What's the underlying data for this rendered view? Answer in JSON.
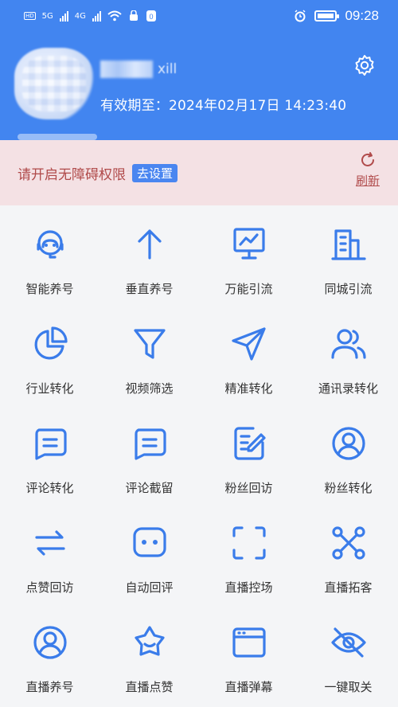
{
  "status_bar": {
    "time": "09:28",
    "net_1": "5G",
    "net_2": "4G"
  },
  "profile": {
    "username_suffix": "xill",
    "expiry": "有效期至：2024年02月17日 14:23:40"
  },
  "notice": {
    "text": "请开启无障碍权限",
    "action": "去设置",
    "refresh": "刷新"
  },
  "features": [
    {
      "label": "智能养号",
      "icon": "robot-icon"
    },
    {
      "label": "垂直养号",
      "icon": "arrow-up-icon"
    },
    {
      "label": "万能引流",
      "icon": "chart-board-icon"
    },
    {
      "label": "同城引流",
      "icon": "building-icon"
    },
    {
      "label": "行业转化",
      "icon": "pie-chart-icon"
    },
    {
      "label": "视频筛选",
      "icon": "filter-icon"
    },
    {
      "label": "精准转化",
      "icon": "navigation-icon"
    },
    {
      "label": "通讯录转化",
      "icon": "contacts-icon"
    },
    {
      "label": "评论转化",
      "icon": "comment-icon"
    },
    {
      "label": "评论截留",
      "icon": "comment-icon"
    },
    {
      "label": "粉丝回访",
      "icon": "edit-note-icon"
    },
    {
      "label": "粉丝转化",
      "icon": "user-circle-icon"
    },
    {
      "label": "点赞回访",
      "icon": "swap-icon"
    },
    {
      "label": "自动回评",
      "icon": "chat-dots-icon"
    },
    {
      "label": "直播控场",
      "icon": "scan-frame-icon"
    },
    {
      "label": "直播拓客",
      "icon": "network-icon"
    },
    {
      "label": "直播养号",
      "icon": "user-circle-icon"
    },
    {
      "label": "直播点赞",
      "icon": "star-badge-icon"
    },
    {
      "label": "直播弹幕",
      "icon": "browser-window-icon"
    },
    {
      "label": "一键取关",
      "icon": "eye-off-icon"
    }
  ],
  "colors": {
    "brand": "#4285f0",
    "icon": "#3a7cea",
    "notice_bg": "#f4e1e4",
    "notice_text": "#b04a4a"
  }
}
